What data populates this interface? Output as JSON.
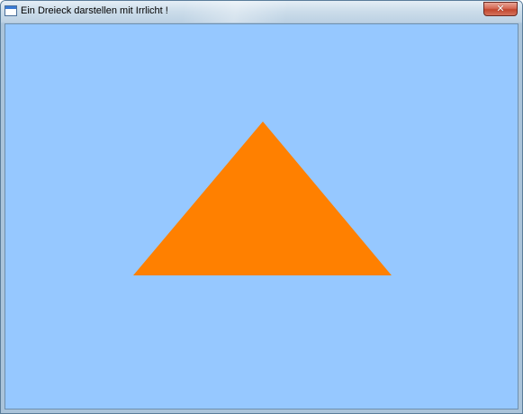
{
  "window": {
    "title": "Ein Dreieck darstellen mit Irrlicht !",
    "icon": "window-app-icon",
    "close_glyph": "✕"
  },
  "colors": {
    "viewport_background": "#96c8ff",
    "triangle_fill": "#ff8000"
  },
  "scene": {
    "shape": "triangle"
  }
}
